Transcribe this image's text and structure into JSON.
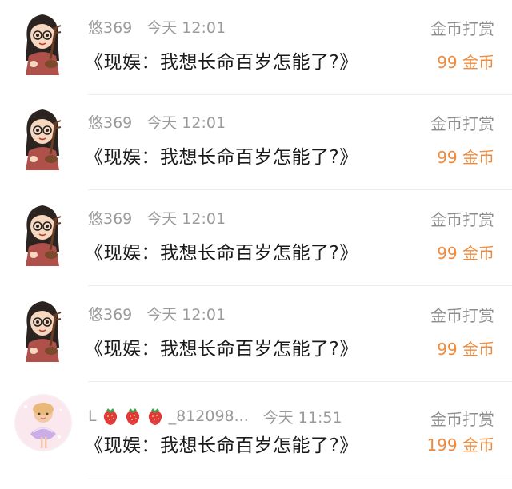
{
  "items": [
    {
      "username": "悠369",
      "time": "今天 12:01",
      "title": "《现娱：我想长命百岁怎能了?》",
      "type": "金币打赏",
      "amount": "99 金币"
    },
    {
      "username": "悠369",
      "time": "今天 12:01",
      "title": "《现娱：我想长命百岁怎能了?》",
      "type": "金币打赏",
      "amount": "99 金币"
    },
    {
      "username": "悠369",
      "time": "今天 12:01",
      "title": "《现娱：我想长命百岁怎能了?》",
      "type": "金币打赏",
      "amount": "99 金币"
    },
    {
      "username": "悠369",
      "time": "今天 12:01",
      "title": "《现娱：我想长命百岁怎能了?》",
      "type": "金币打赏",
      "amount": "99 金币"
    },
    {
      "username_prefix": "L",
      "username_suffix": "_812098...",
      "time": "今天 11:51",
      "title": "《现娱：我想长命百岁怎能了?》",
      "type": "金币打赏",
      "amount": "199 金币"
    }
  ],
  "colors": {
    "amount": "#ef8a3c",
    "meta": "#9a9a9a",
    "title": "#1a1a1a"
  }
}
